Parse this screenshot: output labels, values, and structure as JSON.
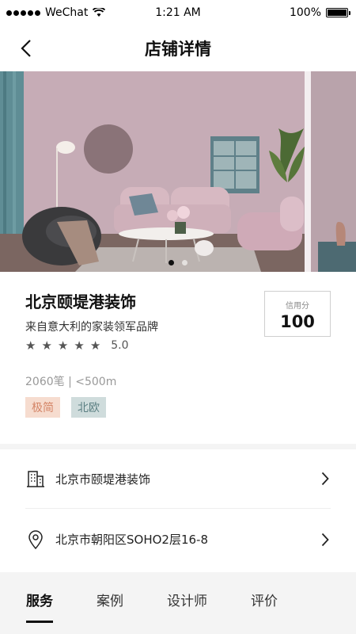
{
  "status": {
    "carrier": "WeChat",
    "time": "1:21 AM",
    "battery": "100%"
  },
  "nav": {
    "title": "店铺详情"
  },
  "hero": {
    "image_desc": "living-room-photo",
    "slides": 2,
    "active_index": 0
  },
  "shop": {
    "name": "北京颐堤港装饰",
    "slogan": "来自意大利的家装领军品牌",
    "rating": {
      "stars": 5,
      "score": "5.0"
    },
    "meta": "2060笔 | <500m",
    "tags": [
      "极简",
      "北欧"
    ],
    "credit": {
      "label": "信用分",
      "value": "100"
    }
  },
  "rows": [
    {
      "icon": "building-icon",
      "text": "北京市颐堤港装饰"
    },
    {
      "icon": "location-pin-icon",
      "text": "北京市朝阳区SOHO2层16-8"
    }
  ],
  "tabs": [
    {
      "label": "服务",
      "active": true
    },
    {
      "label": "案例",
      "active": false
    },
    {
      "label": "设计师",
      "active": false
    },
    {
      "label": "评价",
      "active": false
    }
  ],
  "colors": {
    "tag1_bg": "#f6dccf",
    "tag2_bg": "#cfdcdc",
    "wall": "#c7adb7"
  }
}
